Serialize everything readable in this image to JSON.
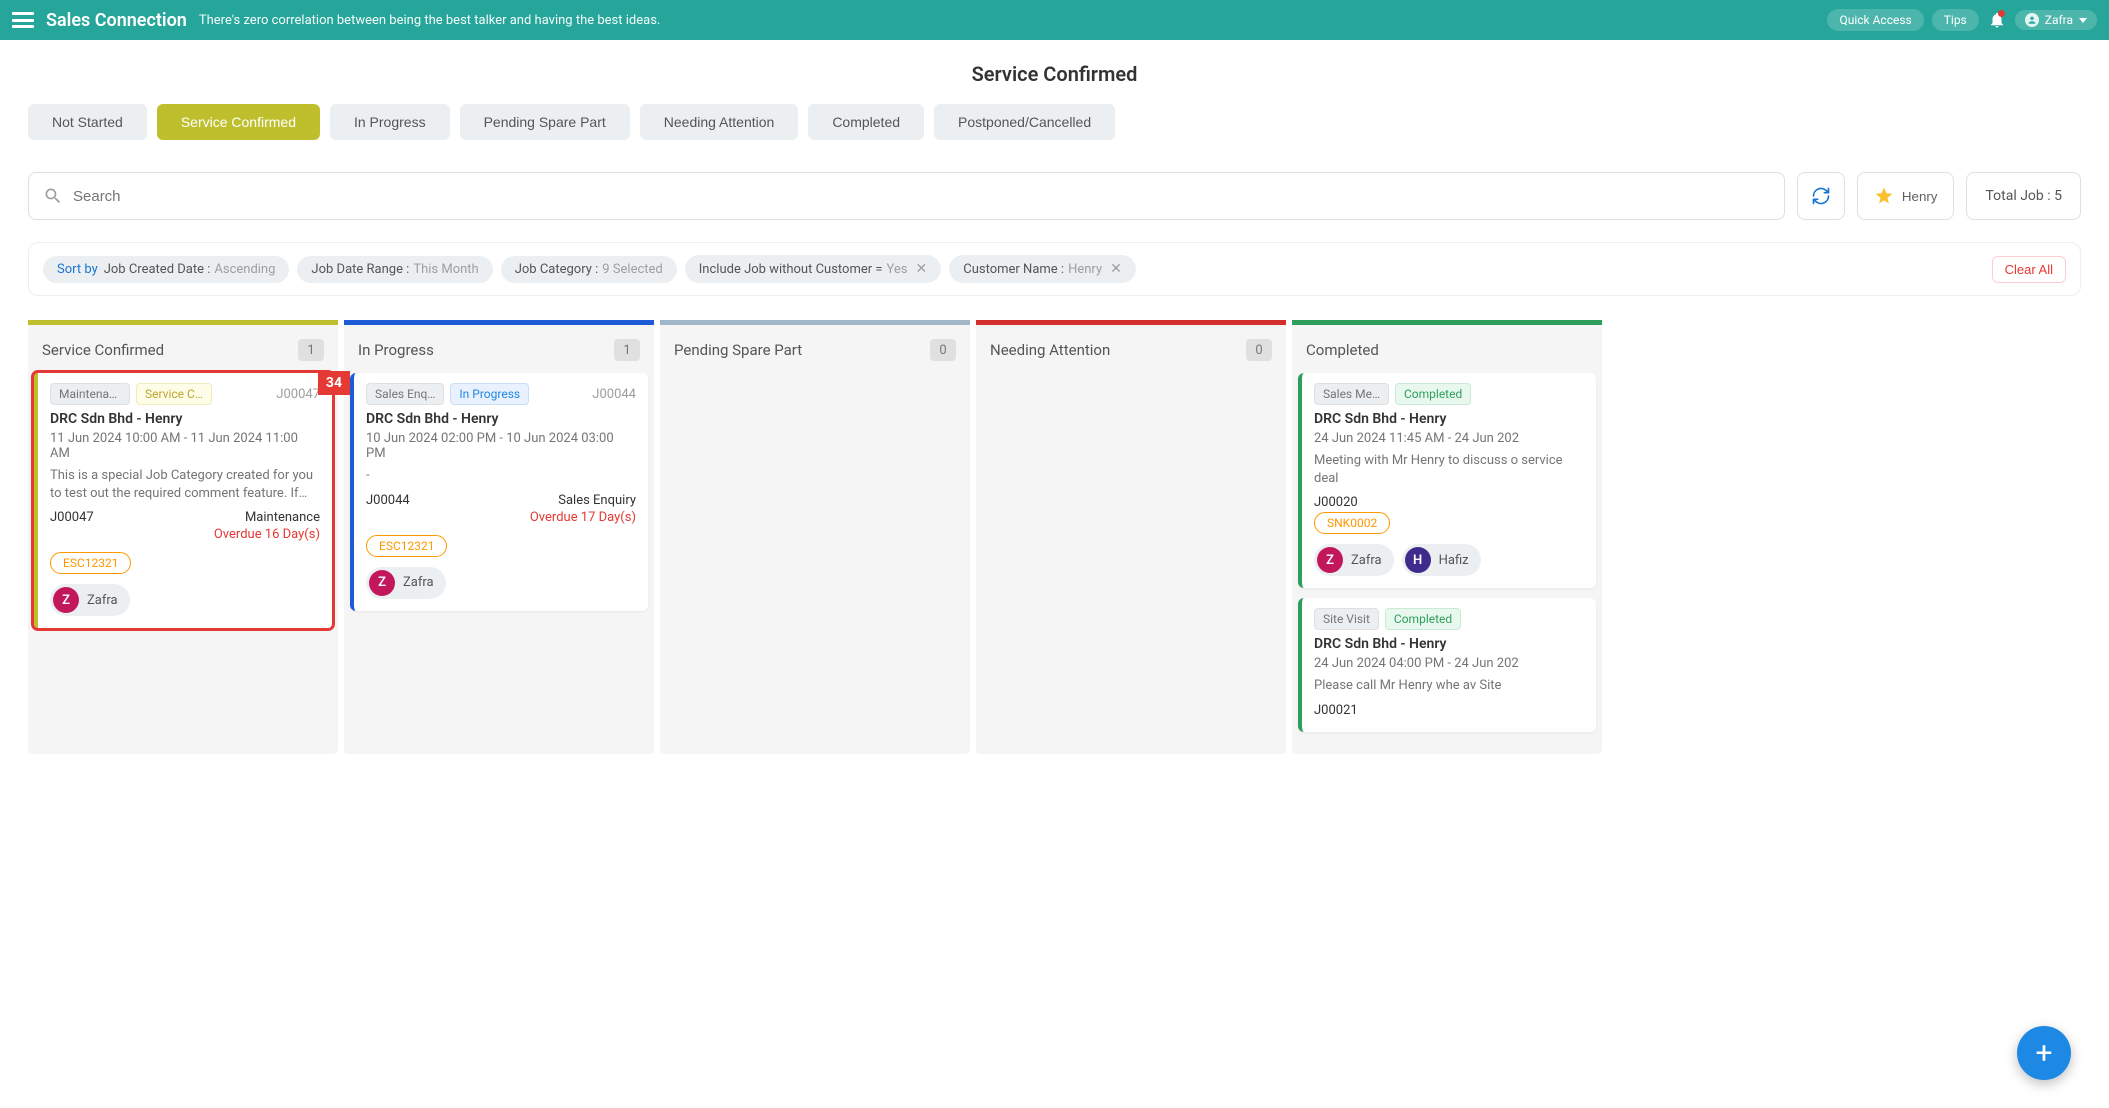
{
  "header": {
    "brand": "Sales Connection",
    "tagline": "There's zero correlation between being the best talker and having the best ideas.",
    "quick_access": "Quick Access",
    "tips": "Tips",
    "user": "Zafra"
  },
  "page_title": "Service Confirmed",
  "status_tabs": [
    {
      "label": "Not Started",
      "active": false
    },
    {
      "label": "Service Confirmed",
      "active": true
    },
    {
      "label": "In Progress",
      "active": false
    },
    {
      "label": "Pending Spare Part",
      "active": false
    },
    {
      "label": "Needing Attention",
      "active": false
    },
    {
      "label": "Completed",
      "active": false
    },
    {
      "label": "Postponed/Cancelled",
      "active": false
    }
  ],
  "search_placeholder": "Search",
  "favorite_name": "Henry",
  "total_label": "Total Job :",
  "total_value": "5",
  "sort_prefix": "Sort by",
  "sort_field": "Job Created Date :",
  "sort_dir": "Ascending",
  "filters": [
    {
      "k": "Job Date Range :",
      "v": "This Month",
      "x": false
    },
    {
      "k": "Job Category :",
      "v": "9 Selected",
      "x": false
    },
    {
      "k": "Include Job without Customer =",
      "v": "Yes",
      "x": true
    },
    {
      "k": "Customer Name :",
      "v": "Henry",
      "x": true
    }
  ],
  "clear_all": "Clear All",
  "columns": [
    {
      "title": "Service Confirmed",
      "count": "1",
      "bar_color": "#bfbf2e",
      "cards": [
        {
          "selected": true,
          "badge": "34",
          "border": "#bfbf2e",
          "tag1": "Maintenan…",
          "tag2": "Service C…",
          "tag2_class": "yellow",
          "jobno": "J00047",
          "title": "DRC Sdn Bhd - Henry",
          "date": "11 Jun 2024 10:00 AM - 11 Jun 2024 11:00 AM",
          "desc": "This is a special Job Category created for you to test out the required comment feature. If you tri…",
          "meta_left": "J00047",
          "meta_right": "Maintenance",
          "overdue": "Overdue 16 Day(s)",
          "ref": "ESC12321",
          "assignees": [
            {
              "initial": "Z",
              "name": "Zafra",
              "color": "pink"
            }
          ]
        }
      ]
    },
    {
      "title": "In Progress",
      "count": "1",
      "bar_color": "#1e5bd6",
      "cards": [
        {
          "border": "#1e5bd6",
          "tag1": "Sales Enq…",
          "tag2": "In Progress",
          "tag2_class": "blue",
          "jobno": "J00044",
          "title": "DRC Sdn Bhd - Henry",
          "date": "10 Jun 2024 02:00 PM - 10 Jun 2024 03:00 PM",
          "desc": "-",
          "meta_left": "J00044",
          "meta_right": "Sales Enquiry",
          "overdue": "Overdue 17 Day(s)",
          "ref": "ESC12321",
          "assignees": [
            {
              "initial": "Z",
              "name": "Zafra",
              "color": "pink"
            }
          ]
        }
      ]
    },
    {
      "title": "Pending Spare Part",
      "count": "0",
      "bar_color": "#9fb7c9",
      "cards": []
    },
    {
      "title": "Needing Attention",
      "count": "0",
      "bar_color": "#d32f2f",
      "cards": []
    },
    {
      "title": "Completed",
      "count": "",
      "bar_color": "#2e9e5b",
      "cards": [
        {
          "border": "#2e9e5b",
          "tag1": "Sales Me…",
          "tag2": "Completed",
          "tag2_class": "green",
          "jobno": "",
          "title": "DRC Sdn Bhd - Henry",
          "date": "24 Jun 2024 11:45 AM - 24 Jun 202",
          "desc": "Meeting with Mr Henry to discuss o service deal",
          "meta_left": "J00020",
          "meta_right": "",
          "overdue": "",
          "ref": "SNK0002",
          "assignees": [
            {
              "initial": "Z",
              "name": "Zafra",
              "color": "pink"
            },
            {
              "initial": "H",
              "name": "Hafiz",
              "color": "purple"
            }
          ]
        },
        {
          "border": "#2e9e5b",
          "tag1": "Site Visit",
          "tag2": "Completed",
          "tag2_class": "green",
          "jobno": "",
          "title": "DRC Sdn Bhd - Henry",
          "date": "24 Jun 2024 04:00 PM - 24 Jun 202",
          "desc": "Please call Mr Henry whe av Site",
          "meta_left": "J00021",
          "meta_right": "",
          "overdue": "",
          "ref": "",
          "assignees": []
        }
      ]
    }
  ]
}
